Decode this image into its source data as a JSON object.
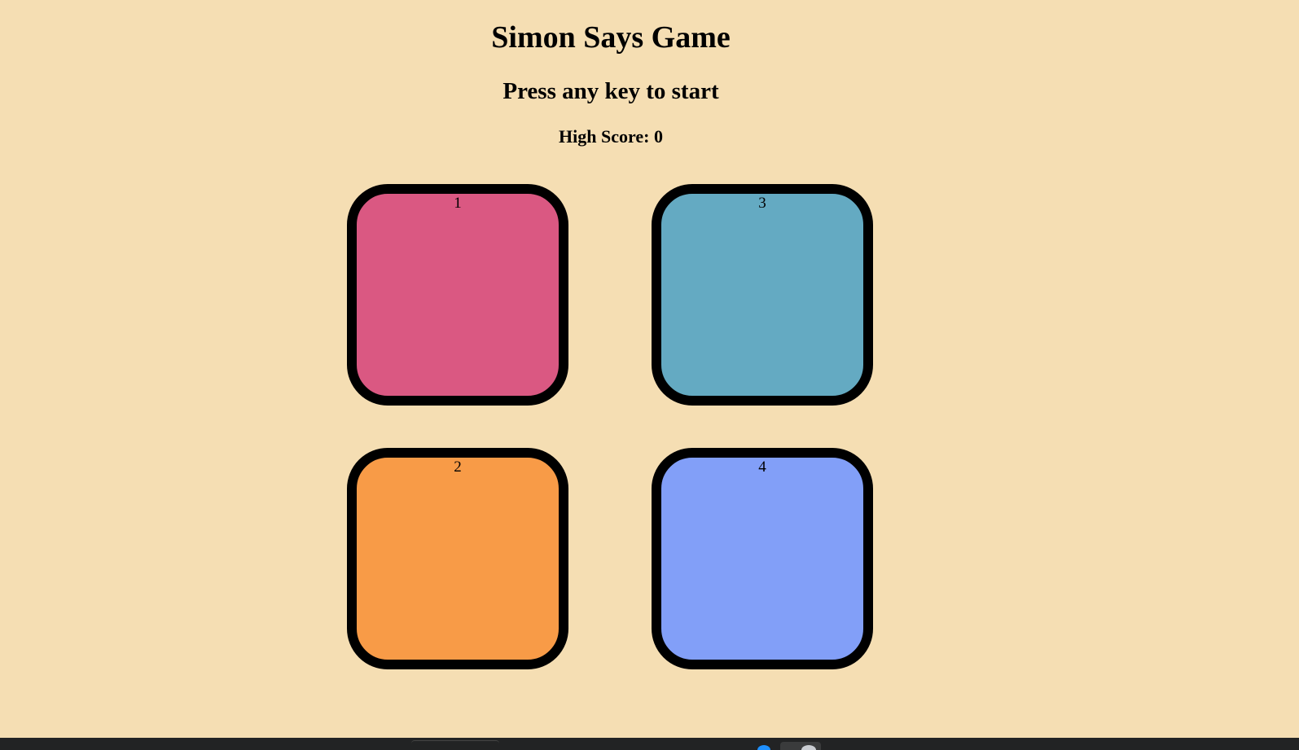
{
  "game": {
    "title": "Simon Says Game",
    "status": "Press any key to start",
    "high_score_label": "High Score: 0",
    "high_score": 0
  },
  "buttons": [
    {
      "label": "1",
      "color": "#da5882"
    },
    {
      "label": "2",
      "color": "#f89b47"
    },
    {
      "label": "3",
      "color": "#64aac2"
    },
    {
      "label": "4",
      "color": "#829ff8"
    }
  ],
  "colors": {
    "background": "#f5deb3",
    "border": "#000000",
    "taskbar": "#222324"
  }
}
